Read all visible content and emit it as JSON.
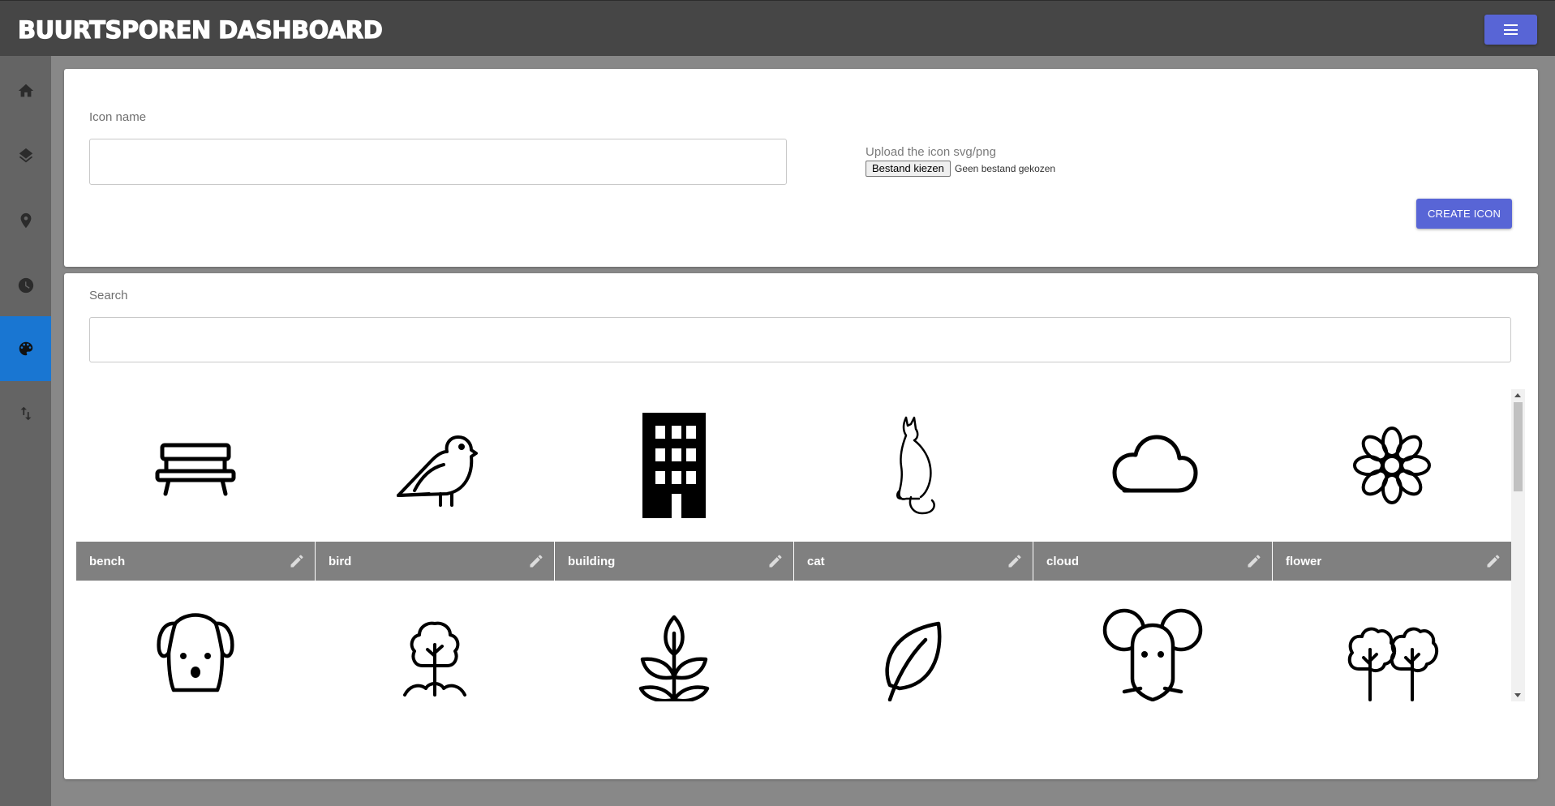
{
  "header": {
    "title": "BUURTSPOREN DASHBOARD",
    "menu_icon": "hamburger-menu-icon",
    "accent_color": "#5865d6"
  },
  "sidebar": {
    "items": [
      {
        "name": "home",
        "icon": "home-icon",
        "active": false
      },
      {
        "name": "layers",
        "icon": "layers-icon",
        "active": false
      },
      {
        "name": "location",
        "icon": "map-pin-icon",
        "active": false
      },
      {
        "name": "history",
        "icon": "clock-icon",
        "active": false
      },
      {
        "name": "icons",
        "icon": "palette-icon",
        "active": true
      },
      {
        "name": "sort",
        "icon": "swap-vertical-icon",
        "active": false
      }
    ],
    "active_color": "#1976d2"
  },
  "create_form": {
    "icon_name_label": "Icon name",
    "icon_name_value": "",
    "upload_label": "Upload the icon svg/png",
    "file_button_label": "Bestand kiezen",
    "file_status": "Geen bestand gekozen",
    "create_button_label": "CREATE ICON"
  },
  "search": {
    "label": "Search",
    "value": ""
  },
  "icons": [
    {
      "name": "bench",
      "icon": "bench-icon"
    },
    {
      "name": "bird",
      "icon": "bird-icon"
    },
    {
      "name": "building",
      "icon": "building-icon"
    },
    {
      "name": "cat",
      "icon": "cat-icon"
    },
    {
      "name": "cloud",
      "icon": "cloud-icon"
    },
    {
      "name": "flower",
      "icon": "flower-icon"
    },
    {
      "name": "",
      "icon": "dog-icon"
    },
    {
      "name": "",
      "icon": "tree-sprout-icon"
    },
    {
      "name": "",
      "icon": "plant-icon"
    },
    {
      "name": "",
      "icon": "leaf-icon"
    },
    {
      "name": "",
      "icon": "mouse-icon"
    },
    {
      "name": "",
      "icon": "trees-icon"
    }
  ]
}
